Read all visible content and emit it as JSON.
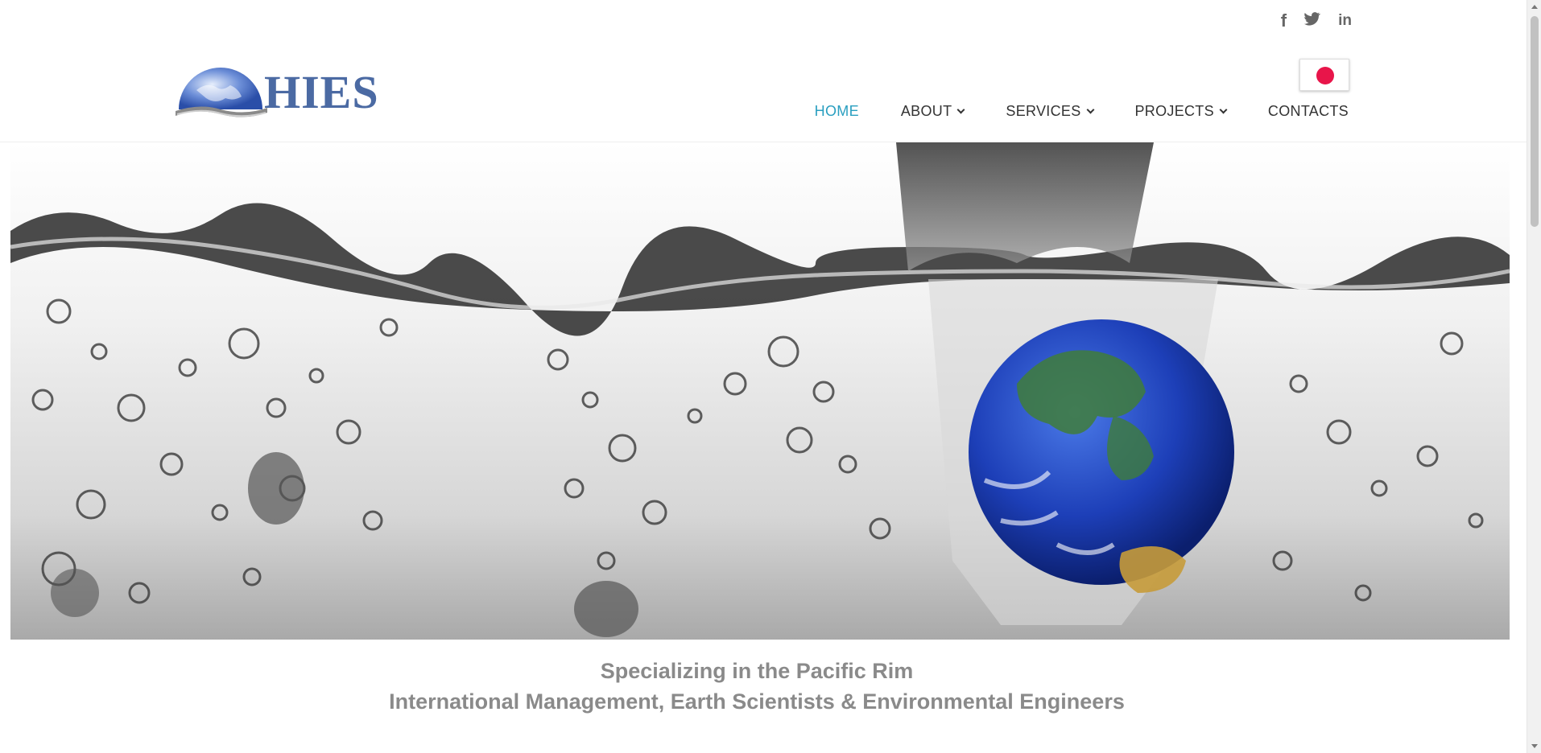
{
  "brand": {
    "logo_text": "HIES",
    "accent_color": "#2a9fc0",
    "logo_color": "#4b6aa3"
  },
  "social": {
    "facebook": "f",
    "twitter": "🐦",
    "linkedin": "in"
  },
  "language_flag": "japan-flag-icon",
  "nav": {
    "items": [
      {
        "label": "HOME",
        "active": true
      },
      {
        "label": "ABOUT",
        "dropdown": true
      },
      {
        "label": "SERVICES",
        "dropdown": true
      },
      {
        "label": "PROJECTS",
        "dropdown": true
      },
      {
        "label": "CONTACTS"
      }
    ]
  },
  "tagline": {
    "line1": "Specializing in the Pacific Rim",
    "line2": "International Management, Earth Scientists & Environmental Engineers"
  }
}
